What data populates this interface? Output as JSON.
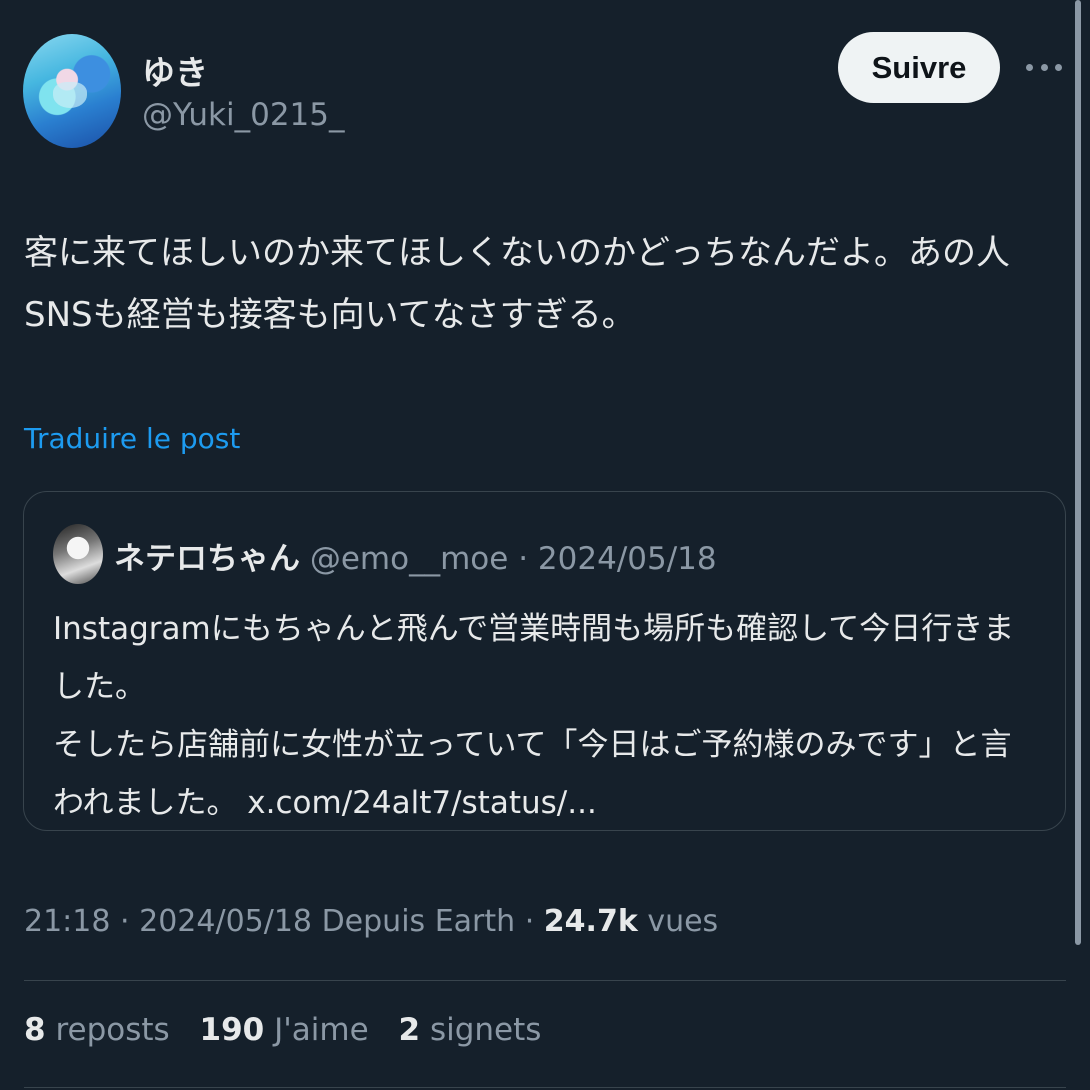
{
  "author": {
    "display_name": "ゆき",
    "handle": "@Yuki_0215_"
  },
  "follow_button": "Suivre",
  "more_icon": "more-horizontal-icon",
  "tweet": {
    "text": "客に来てほしいのか来てほしくないのかどっちなんだよ。あの人\nSNSも経営も接客も向いてなさすぎる。",
    "translate_link": "Traduire le post"
  },
  "quote": {
    "display_name": "ネテロちゃん",
    "handle": "@emo__moe",
    "date": "2024/05/18",
    "separator": "·",
    "text": "Instagramにもちゃんと飛んで営業時間も場所も確認して今日行きました。\nそしたら店舗前に女性が立っていて「今日はご予約様のみです」と言われました。 x.com/24alt7/status/..."
  },
  "meta": {
    "time": "21:18",
    "date": "2024/05/18",
    "source": "Depuis Earth",
    "separator": "·",
    "views": "24.7k",
    "views_label": "vues"
  },
  "stats": {
    "reposts_count": "8",
    "reposts_label": "reposts",
    "likes_count": "190",
    "likes_label": "J'aime",
    "bookmarks_count": "2",
    "bookmarks_label": "signets"
  },
  "colors": {
    "background": "#15202b",
    "text": "#e7e9ea",
    "secondary": "#8b98a5",
    "accent": "#1d9bf0",
    "border": "#38444d"
  }
}
